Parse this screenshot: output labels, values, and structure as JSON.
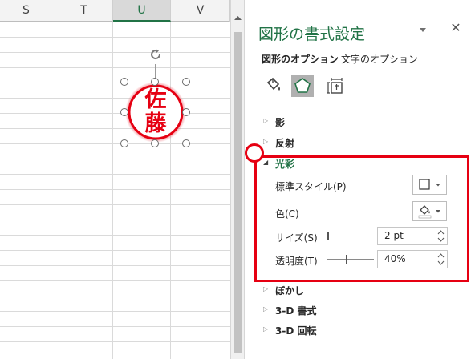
{
  "sheet": {
    "columns": [
      "S",
      "T",
      "U",
      "V"
    ],
    "selected_column": "U"
  },
  "stamp": {
    "text_top": "佐",
    "text_bottom": "藤",
    "color": "#e60012"
  },
  "pane": {
    "title": "図形の書式設定",
    "tabs": {
      "shape_options": "図形のオプション",
      "text_options": "文字のオプション"
    },
    "sections": {
      "shadow": "影",
      "reflection": "反射",
      "glow": "光彩",
      "soft_edges": "ぼかし",
      "format_3d": "3-D 書式",
      "rotation_3d": "3-D 回転"
    },
    "glow": {
      "preset_label": "標準スタイル(P)",
      "color_label": "色(C)",
      "size_label": "サイズ(S)",
      "size_value": "2 pt",
      "transparency_label": "透明度(T)",
      "transparency_value": "40%"
    }
  },
  "colors": {
    "accent": "#217346",
    "highlight": "#e60012"
  },
  "icons": [
    "fill-line-icon",
    "effects-icon",
    "size-properties-icon",
    "rotate-handle-icon",
    "pane-menu-icon",
    "close-icon"
  ]
}
